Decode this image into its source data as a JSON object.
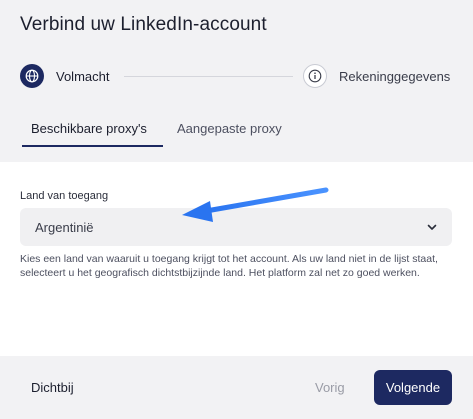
{
  "dialog": {
    "title": "Verbind uw LinkedIn-account"
  },
  "stepper": {
    "steps": [
      {
        "label": "Volmacht",
        "icon": "globe-icon",
        "active": true
      },
      {
        "label": "Rekeninggegevens",
        "icon": "info-icon",
        "active": false
      }
    ]
  },
  "tabs": [
    {
      "label": "Beschikbare proxy's",
      "active": true
    },
    {
      "label": "Aangepaste proxy",
      "active": false
    }
  ],
  "country_field": {
    "label": "Land van toegang",
    "value": "Argentinië",
    "help": "Kies een land van waaruit u toegang krijgt tot het account. Als uw land niet in de lijst staat, selecteert u het geografisch dichtstbijzijnde land. Het platform zal net zo goed werken."
  },
  "footer": {
    "close_label": "Dichtbij",
    "prev_label": "Vorig",
    "next_label": "Volgende"
  },
  "colors": {
    "primary": "#1d2961",
    "panel_bg": "#f2f2f4",
    "annotation_arrow": "#2f7ef7"
  }
}
